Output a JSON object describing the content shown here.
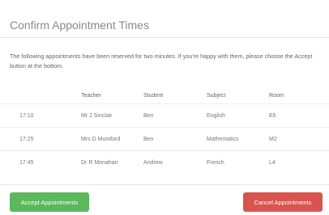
{
  "dialog": {
    "title": "Confirm Appointment Times",
    "intro": "The following appointments have been reserved for two minutes. If you're happy with them, please choose the Accept button at the bottom."
  },
  "table": {
    "headers": [
      "",
      "Teacher",
      "Student",
      "Subject",
      "Room"
    ],
    "rows": [
      [
        "17:10",
        "Mr J Sinclair",
        "Ben",
        "English",
        "E6"
      ],
      [
        "17:25",
        "Mrs D Mumford",
        "Ben",
        "Mathematics",
        "M2"
      ],
      [
        "17:45",
        "Dr R Monahan",
        "Andrew",
        "French",
        "L4"
      ]
    ]
  },
  "buttons": {
    "accept_label": "Accept Appointments",
    "cancel_label": "Cancel Appointments"
  },
  "colors": {
    "accept": "#5cb85c",
    "cancel": "#d9534f"
  }
}
